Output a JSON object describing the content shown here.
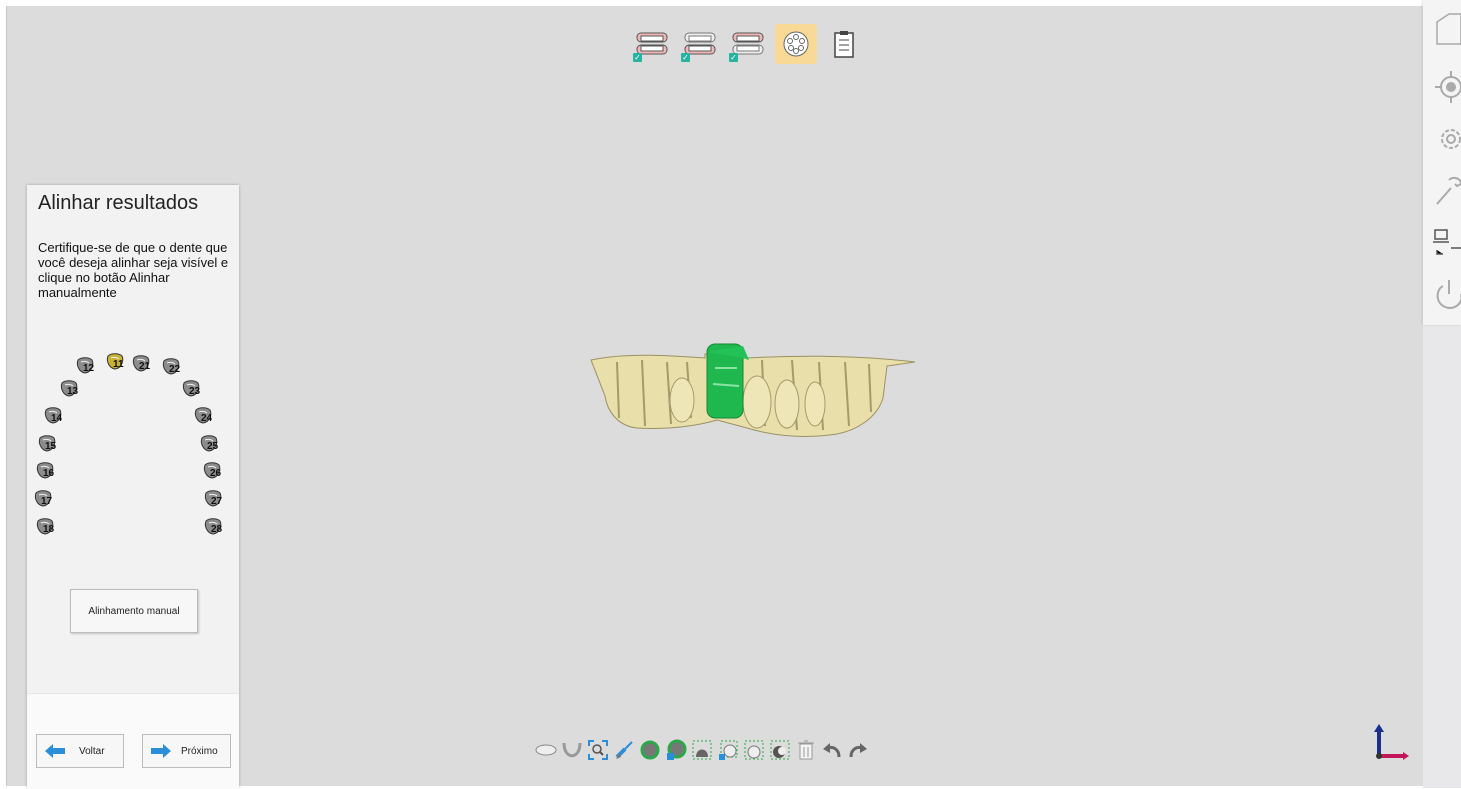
{
  "top_toolbar": {
    "modes": [
      {
        "name": "upper-jaw-scan",
        "checked": true,
        "active": false
      },
      {
        "name": "lower-jaw-scan",
        "checked": true,
        "active": false
      },
      {
        "name": "bite-scan",
        "checked": true,
        "active": false
      },
      {
        "name": "die-scan",
        "checked": false,
        "active": true
      },
      {
        "name": "order-info",
        "checked": false,
        "active": false
      }
    ]
  },
  "panel": {
    "title": "Alinhar resultados",
    "instructions": "Certifique-se de que o dente que você deseja alinhar seja visível e clique no botão Alinhar manualmente",
    "teeth": [
      "12",
      "11",
      "21",
      "22",
      "13",
      "23",
      "14",
      "24",
      "15",
      "25",
      "16",
      "26",
      "17",
      "27",
      "18",
      "28"
    ],
    "selected_tooth": "11",
    "manual_button": "Alinhamento manual",
    "back_button": "Voltar",
    "next_button": "Próximo"
  },
  "right_sidebar": {
    "icons": [
      "new-file-icon",
      "target-icon",
      "settings-icon",
      "wrench-icon",
      "network-icon",
      "power-icon"
    ]
  },
  "bottom_toolbar": {
    "tools": [
      "upper-jaw-view-icon",
      "lower-jaw-view-icon",
      "zoom-fit-icon",
      "brush-icon",
      "show-region-icon",
      "hide-region-icon",
      "select-region-icon",
      "deselect-region-icon",
      "lasso-select-icon",
      "invert-select-icon",
      "delete-icon",
      "undo-icon",
      "redo-icon"
    ]
  },
  "colors": {
    "viewport": "#dcdcdc",
    "active_mode": "#f8d996",
    "die_green": "#1fb84e",
    "model_beige": "#e6dba4",
    "accent_blue": "#2a8fd8"
  }
}
